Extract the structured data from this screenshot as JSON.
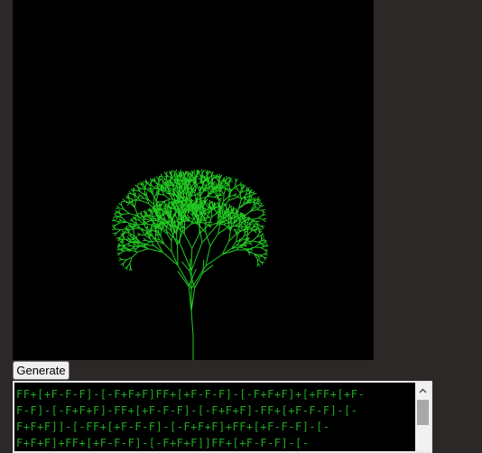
{
  "canvas": {
    "background": "#000000",
    "branch_color": "#22cc22"
  },
  "controls": {
    "generate_label": "Generate"
  },
  "output": {
    "lines": [
      "FF+[+F-F-F]-[-F+F+F]FF+[+F-F-F]-[-F+F+F]+[+FF+[+F-",
      "F-F]-[-F+F+F]-FF+[+F-F-F]-[-F+F+F]-FF+[+F-F-F]-[-",
      "F+F+F]]-[-FF+[+F-F-F]-[-F+F+F]+FF+[+F-F-F]-[-",
      "F+F+F]+FF+[+F-F-F]-[-F+F+F]]FF+[+F-F-F]-[-"
    ],
    "text_color": "#22aa22",
    "icons": {
      "scroll_up": "chevron-up-icon"
    }
  }
}
